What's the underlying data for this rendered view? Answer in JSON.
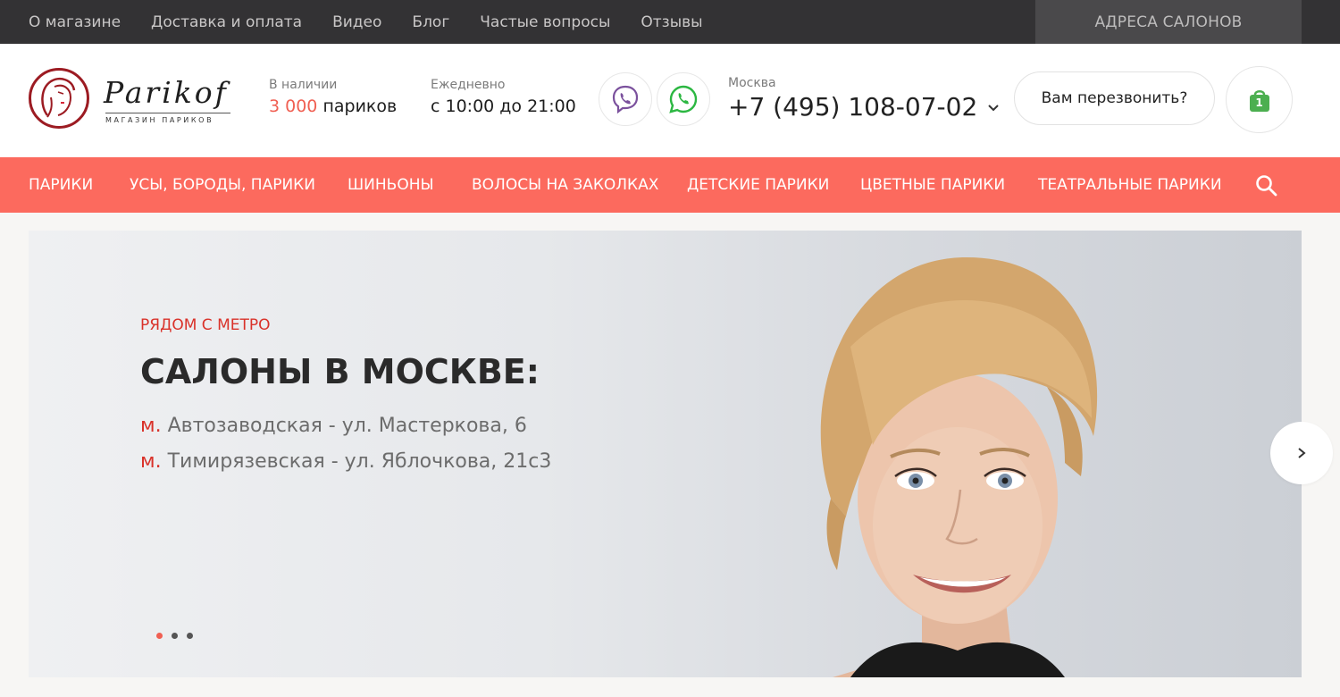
{
  "topbar": {
    "links": [
      "О магазине",
      "Доставка и оплата",
      "Видео",
      "Блог",
      "Частые вопросы",
      "Отзывы"
    ],
    "salons_button": "АДРЕСА САЛОНОВ"
  },
  "header": {
    "logo": {
      "name": "Parikof",
      "subtitle": "МАГАЗИН ПАРИКОВ"
    },
    "stock": {
      "label": "В наличии",
      "count": "3 000",
      "suffix": "париков"
    },
    "hours": {
      "label": "Ежедневно",
      "value": "с 10:00 до 21:00"
    },
    "messengers": [
      {
        "icon": "viber-icon",
        "color": "#7b519d"
      },
      {
        "icon": "whatsapp-icon",
        "color": "#2cb742"
      }
    ],
    "phone": {
      "city": "Москва",
      "number": "+7 (495) 108-07-02"
    },
    "callback_button": "Вам перезвонить?",
    "cart": {
      "count": "1",
      "color": "#4caf50"
    }
  },
  "nav": {
    "items": [
      "ПАРИКИ",
      "УСЫ, БОРОДЫ, ПАРИКИ",
      "ШИНЬОНЫ",
      "ВОЛОСЫ НА ЗАКОЛКАХ",
      "ДЕТСКИЕ ПАРИКИ",
      "ЦВЕТНЫЕ ПАРИКИ",
      "ТЕАТРАЛЬНЫЕ ПАРИКИ"
    ],
    "bg_color": "#fc6a5e"
  },
  "hero": {
    "eyebrow": "РЯДОМ С МЕТРО",
    "title": "САЛОНЫ В МОСКВЕ:",
    "addresses": [
      {
        "prefix": "м.",
        "text": "Автозаводская - ул. Мастеркова, 6"
      },
      {
        "prefix": "м.",
        "text": "Тимирязевская - ул. Яблочкова, 21с3"
      }
    ],
    "slides_total": 3,
    "active_slide": 1
  }
}
